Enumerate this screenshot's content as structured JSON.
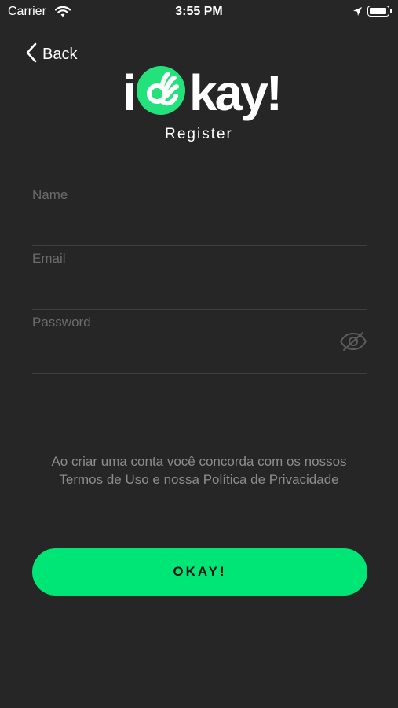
{
  "status_bar": {
    "carrier": "Carrier",
    "time": "3:55 PM",
    "battery_level": 1.0
  },
  "nav": {
    "back_label": "Back"
  },
  "logo": {
    "part1": "i",
    "part2": "kay!",
    "subtitle": "Register",
    "accent_color": "#23e27b"
  },
  "form": {
    "name_label": "Name",
    "email_label": "Email",
    "password_label": "Password",
    "name_value": "",
    "email_value": "",
    "password_value": ""
  },
  "terms": {
    "text_before": "Ao criar uma conta você concorda com os nossos ",
    "terms_link": "Termos de Uso",
    "text_middle": " e nossa ",
    "privacy_link": "Política de Privacidade"
  },
  "submit": {
    "label": "OKAY!",
    "color": "#00e676"
  },
  "icons": [
    "wifi-icon",
    "location-arrow-icon",
    "battery-icon",
    "chevron-left-icon",
    "ok-hand-icon",
    "eye-off-icon"
  ]
}
